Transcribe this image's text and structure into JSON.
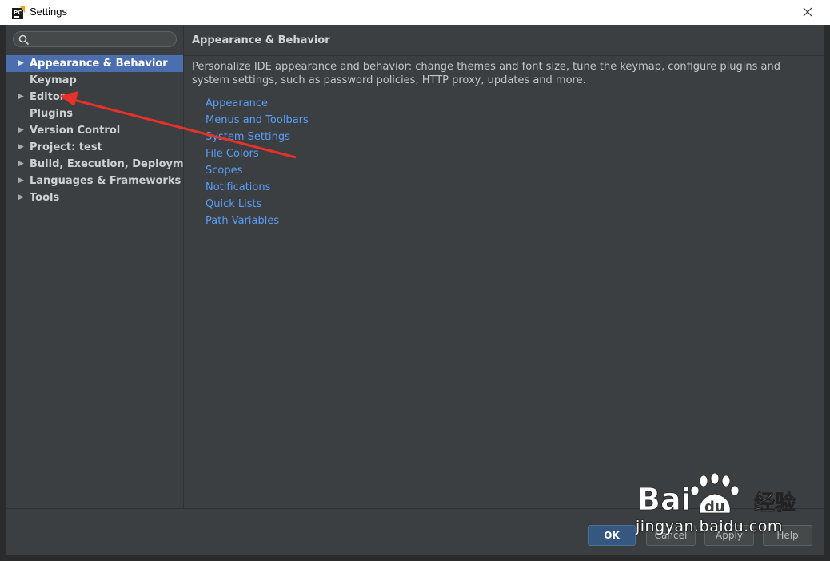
{
  "window": {
    "title": "Settings"
  },
  "search": {
    "placeholder": "",
    "value": ""
  },
  "sidebar": {
    "items": [
      {
        "label": "Appearance & Behavior",
        "expandable": true,
        "selected": true
      },
      {
        "label": "Keymap",
        "expandable": false,
        "selected": false
      },
      {
        "label": "Editor",
        "expandable": true,
        "selected": false
      },
      {
        "label": "Plugins",
        "expandable": false,
        "selected": false
      },
      {
        "label": "Version Control",
        "expandable": true,
        "selected": false
      },
      {
        "label": "Project: test",
        "expandable": true,
        "selected": false
      },
      {
        "label": "Build, Execution, Deployment",
        "expandable": true,
        "selected": false
      },
      {
        "label": "Languages & Frameworks",
        "expandable": true,
        "selected": false
      },
      {
        "label": "Tools",
        "expandable": true,
        "selected": false
      }
    ]
  },
  "main": {
    "title": "Appearance & Behavior",
    "description": "Personalize IDE appearance and behavior: change themes and font size, tune the keymap, configure plugins and system settings, such as password policies, HTTP proxy, updates and more.",
    "links": [
      "Appearance",
      "Menus and Toolbars",
      "System Settings",
      "File Colors",
      "Scopes",
      "Notifications",
      "Quick Lists",
      "Path Variables"
    ]
  },
  "footer": {
    "ok_label": "OK",
    "cancel_label": "Cancel",
    "apply_label": "Apply",
    "help_label": "Help"
  },
  "watermark": {
    "logo_text": "Bai du 经验",
    "url": "jingyan.baidu.com"
  },
  "colors": {
    "selection": "#4b6eaf",
    "link": "#589df6",
    "background": "#3c3f41",
    "annotation_arrow": "#e8312a"
  }
}
